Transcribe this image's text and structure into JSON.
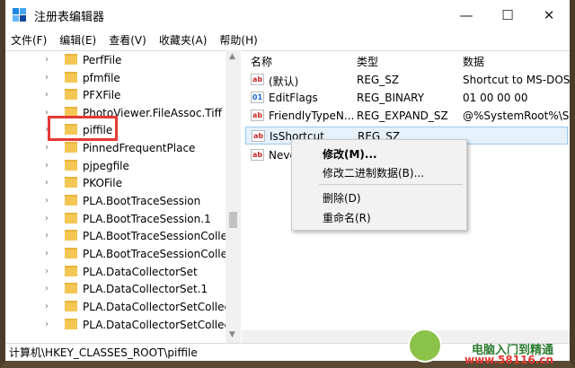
{
  "window": {
    "title": "注册表编辑器",
    "min_icon": "minimize-icon",
    "max_icon": "maximize-icon",
    "close_icon": "close-icon"
  },
  "menu": [
    "文件(F)",
    "编辑(E)",
    "查看(V)",
    "收藏夹(A)",
    "帮助(H)"
  ],
  "tree": [
    {
      "label": "PerfFile",
      "chevron": "›"
    },
    {
      "label": "pfmfile",
      "chevron": "›"
    },
    {
      "label": "PFXFile",
      "chevron": "›"
    },
    {
      "label": "PhotoViewer.FileAssoc.Tiff",
      "chevron": "›"
    },
    {
      "label": "piffile",
      "chevron": "›"
    },
    {
      "label": "PinnedFrequentPlace",
      "chevron": "›"
    },
    {
      "label": "pjpegfile",
      "chevron": "›"
    },
    {
      "label": "PKOFile",
      "chevron": "›"
    },
    {
      "label": "PLA.BootTraceSession",
      "chevron": "›"
    },
    {
      "label": "PLA.BootTraceSession.1",
      "chevron": "›"
    },
    {
      "label": "PLA.BootTraceSessionCollec",
      "chevron": "›"
    },
    {
      "label": "PLA.BootTraceSessionCollec",
      "chevron": "›"
    },
    {
      "label": "PLA.DataCollectorSet",
      "chevron": "›"
    },
    {
      "label": "PLA.DataCollectorSet.1",
      "chevron": "›"
    },
    {
      "label": "PLA.DataCollectorSetCollect",
      "chevron": "›"
    },
    {
      "label": "PLA.DataCollectorSetCollect",
      "chevron": "›"
    }
  ],
  "list": {
    "columns": [
      "名称",
      "类型",
      "数据"
    ],
    "rows": [
      {
        "name": "(默认)",
        "type": "REG_SZ",
        "data": "Shortcut to MS-DOS"
      },
      {
        "name": "EditFlags",
        "type": "REG_BINARY",
        "data": "01 00 00 00"
      },
      {
        "name": "FriendlyTypeN...",
        "type": "REG_EXPAND_SZ",
        "data": "@%SystemRoot%\\Sy"
      },
      {
        "name": "IsShortcut",
        "type": "REG_SZ",
        "data": ""
      },
      {
        "name": "Neve",
        "type": "",
        "data": ""
      }
    ]
  },
  "context_menu": {
    "modify": "修改(M)...",
    "modify_binary": "修改二进制数据(B)...",
    "delete": "删除(D)",
    "rename": "重命名(R)"
  },
  "status": "计算机\\HKEY_CLASSES_ROOT\\piffile",
  "watermark": {
    "top": "电脑入门到精通",
    "bottom": "www.58116.cn"
  },
  "icon_glyphs": {
    "minimize": "—",
    "maximize": "☐",
    "close": "✕",
    "chevron": "›",
    "scroll_up": "▲",
    "scroll_down": "▼"
  }
}
